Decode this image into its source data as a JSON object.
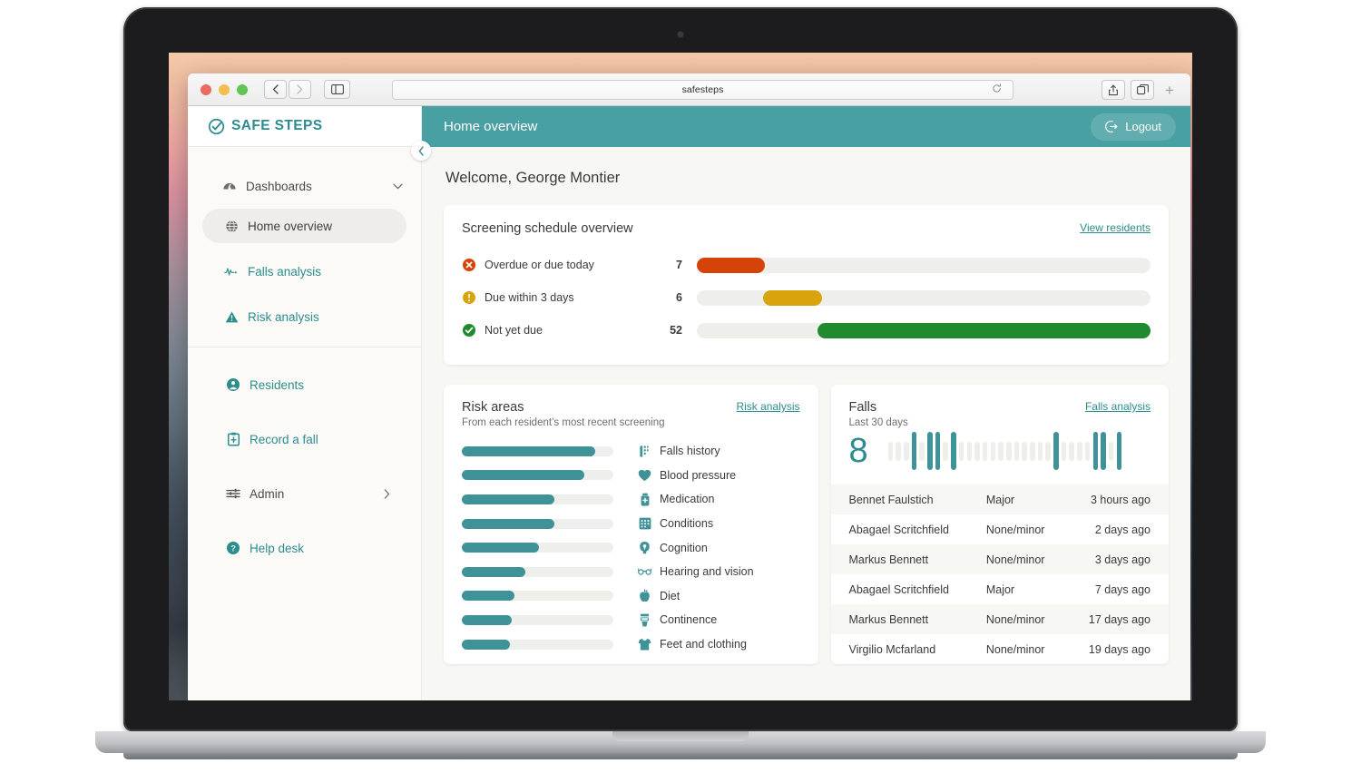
{
  "browser": {
    "url_text": "safesteps",
    "back_icon": "chevron-left-icon",
    "forward_icon": "chevron-right-icon",
    "sidebar_icon": "sidebar-toggle-icon",
    "reload_icon": "reload-icon",
    "share_icon": "share-icon",
    "tabs_icon": "tab-overview-icon",
    "new_tab_label": "+"
  },
  "sidebar": {
    "brand": "SAFE STEPS",
    "brand_icon": "safe-steps-logo-icon",
    "collapse_icon": "chevron-left-icon",
    "group": {
      "label": "Dashboards",
      "icon": "dashboards-icon",
      "caret_icon": "chevron-down-icon",
      "items": [
        {
          "label": "Home overview",
          "icon": "globe-icon",
          "active": true
        },
        {
          "label": "Falls analysis",
          "icon": "pulse-line-icon",
          "active": false
        },
        {
          "label": "Risk analysis",
          "icon": "warning-triangle-icon",
          "active": false
        }
      ]
    },
    "main_items": [
      {
        "label": "Residents",
        "icon": "person-circle-icon",
        "chevron": false
      },
      {
        "label": "Record a fall",
        "icon": "clipboard-icon",
        "chevron": false
      },
      {
        "label": "Admin",
        "icon": "sliders-icon",
        "chevron": true
      },
      {
        "label": "Help desk",
        "icon": "question-circle-icon",
        "chevron": false
      }
    ]
  },
  "header": {
    "title": "Home overview",
    "logout_label": "Logout",
    "logout_icon": "logout-icon"
  },
  "welcome": "Welcome, George Montier",
  "screening": {
    "title": "Screening schedule overview",
    "link": "View residents",
    "rows": [
      {
        "label": "Overdue or due today",
        "count": "7",
        "icon": "error-circle-icon",
        "color": "#d64309",
        "start_pct": 0,
        "width_pct": 15
      },
      {
        "label": "Due within 3 days",
        "count": "6",
        "icon": "warning-circle-icon",
        "color": "#d8a40d",
        "start_pct": 14.5,
        "width_pct": 13
      },
      {
        "label": "Not yet due",
        "count": "52",
        "icon": "check-circle-icon",
        "color": "#1f8a2e",
        "start_pct": 26.5,
        "width_pct": 73.5
      }
    ]
  },
  "risk_areas": {
    "title": "Risk areas",
    "subtitle": "From each resident’s most recent screening",
    "link": "Risk analysis",
    "bar_color": "#3f9298",
    "items": [
      {
        "label": "Falls history",
        "icon": "falls-history-icon",
        "pct": 88
      },
      {
        "label": "Blood pressure",
        "icon": "heart-icon",
        "pct": 81
      },
      {
        "label": "Medication",
        "icon": "medication-bottle-icon",
        "pct": 61
      },
      {
        "label": "Conditions",
        "icon": "conditions-grid-icon",
        "pct": 61
      },
      {
        "label": "Cognition",
        "icon": "brain-icon",
        "pct": 51
      },
      {
        "label": "Hearing and vision",
        "icon": "glasses-icon",
        "pct": 42
      },
      {
        "label": "Diet",
        "icon": "apple-icon",
        "pct": 35
      },
      {
        "label": "Continence",
        "icon": "toilet-icon",
        "pct": 33
      },
      {
        "label": "Feet and clothing",
        "icon": "shirt-icon",
        "pct": 32
      }
    ]
  },
  "falls": {
    "title": "Falls",
    "subtitle": "Last 30 days",
    "link": "Falls analysis",
    "count": "8",
    "sparkline": [
      0,
      0,
      0,
      1,
      0,
      1,
      1,
      0,
      1,
      0,
      0,
      0,
      0,
      0,
      0,
      0,
      0,
      0,
      0,
      0,
      0,
      1,
      0,
      0,
      0,
      0,
      1,
      1,
      0,
      1
    ],
    "rows": [
      {
        "name": "Bennet Faulstich",
        "severity": "Major",
        "time": "3 hours ago"
      },
      {
        "name": "Abagael Scritchfield",
        "severity": "None/minor",
        "time": "2 days ago"
      },
      {
        "name": "Markus Bennett",
        "severity": "None/minor",
        "time": "3 days ago"
      },
      {
        "name": "Abagael Scritchfield",
        "severity": "Major",
        "time": "7 days ago"
      },
      {
        "name": "Markus Bennett",
        "severity": "None/minor",
        "time": "17 days ago"
      },
      {
        "name": "Virgilio Mcfarland",
        "severity": "None/minor",
        "time": "19 days ago"
      }
    ]
  }
}
